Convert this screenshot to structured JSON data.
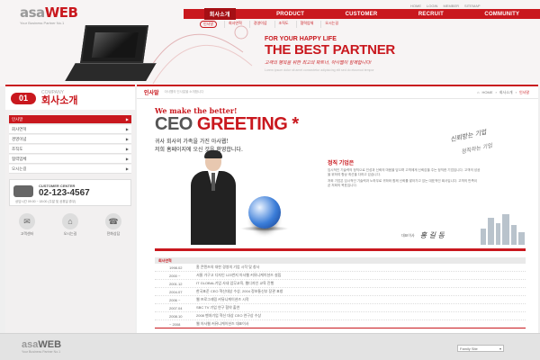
{
  "logo": {
    "brand_a": "asa",
    "brand_b": "WEB",
    "tagline": "Your Business Partner No.1"
  },
  "top_links": [
    "HOME",
    "LOGIN",
    "MEMBER",
    "SITEMAP"
  ],
  "gnb": [
    {
      "label": "회사소개",
      "active": true
    },
    {
      "label": "PRODUCT",
      "active": false
    },
    {
      "label": "CUSTOMER",
      "active": false
    },
    {
      "label": "RECRUIT",
      "active": false
    },
    {
      "label": "COMMUNITY",
      "active": false
    }
  ],
  "subnav": [
    "인사말",
    "회사연혁",
    "경영이념",
    "조직도",
    "협력업체",
    "오시는길"
  ],
  "hero": {
    "line1": "FOR YOUR HAPPY LIFE",
    "line2": "THE BEST PARTNER",
    "line3": "고객의 행복을 위한 최고의 파트너, 아사웹이 함께합니다!",
    "line4": "Lorem ipsum dolor sit amet consectetur adipisicing elit sed do eiusmod tempor"
  },
  "sidebar": {
    "num": "01",
    "en": "COMPANY",
    "ko": "회사소개",
    "menu": [
      "인사말",
      "회사연혁",
      "경영이념",
      "조직도",
      "협력업체",
      "오시는길"
    ],
    "cs": {
      "label": "CUSTOMER CENTER",
      "tel": "02-123-4567",
      "hours": "상담시간 09:00 ~ 18:00 (주말 및 공휴일 휴무)"
    },
    "quick": [
      {
        "icon": "✉",
        "label": "고객센터"
      },
      {
        "icon": "⌂",
        "label": "오시는길"
      },
      {
        "icon": "☎",
        "label": "전화상담"
      }
    ]
  },
  "main": {
    "page_title": "인사말",
    "page_desc": "아사웹의 인사말을 소개합니다",
    "crumb": [
      "HOME",
      "회사소개",
      "인사말"
    ],
    "greet_small": "We make the better!",
    "greet_big_a": "CEO ",
    "greet_big_b": "GREETING *",
    "ko1": "귀사 회사의 가족을 가진 아사웹!",
    "ko2": "저희 홈페이지에 오신 것을 환영합니다.",
    "script1": "신뢰받는 기업",
    "script2": "정직하는 기업",
    "body_head": "정직 기업은",
    "body": [
      "임시적인 기술력의 정직으로 인성과 신뢰의 마음을 담으며 고객에게 신뢰감을 주는 정직한 기업입니다. 고객의 성공을 위하여 항상 최선을 다하고 있습니다.",
      "저희 기업은 임시적인 기술력과 노하우로 귀하와 함께 신뢰를 쌓아가고 있는 대표적인 회사입니다. 고객의 만족이 곧 저희의 목표입니다."
    ],
    "rep_label": "대표이사",
    "rep_name": "홍 길 동"
  },
  "history": {
    "title": "회사연혁",
    "rows": [
      {
        "year": "1998.02",
        "event": "홈 콘텐츠의 대한 경영의 기업 시작 및 창사"
      },
      {
        "year": "2000 ~",
        "event": "서울 가구고 디자인 123번지 아사웹 커뮤니케이션즈 설립"
      },
      {
        "year": "2001.12",
        "event": "IT GLOBAL기업 사내 업무교육, 웹디자인 교육 진행"
      },
      {
        "year": "2004.07",
        "event": "한국표준 CEO 혁신대상 수상, 2004 정보통신부 장관 표창"
      },
      {
        "year": "2006 ~",
        "event": "웹 프로그래밍 커뮤니케이션즈 시작"
      },
      {
        "year": "2007.04",
        "event": "SBC TV 기업 연구 협약 출연"
      },
      {
        "year": "2008.10",
        "event": "2008 벤처기업 혁신 대상 CEO 연구상 수상"
      },
      {
        "year": "~ 2008",
        "event": "웹 아사웹 커뮤니케이션즈 대표이사"
      }
    ]
  },
  "footer": {
    "brand_a": "asa",
    "brand_b": "WEB",
    "tagline": "Your Business Partner No.1",
    "family": "Family Site"
  },
  "colors": {
    "accent": "#c9181e",
    "bg": "#efefef"
  }
}
